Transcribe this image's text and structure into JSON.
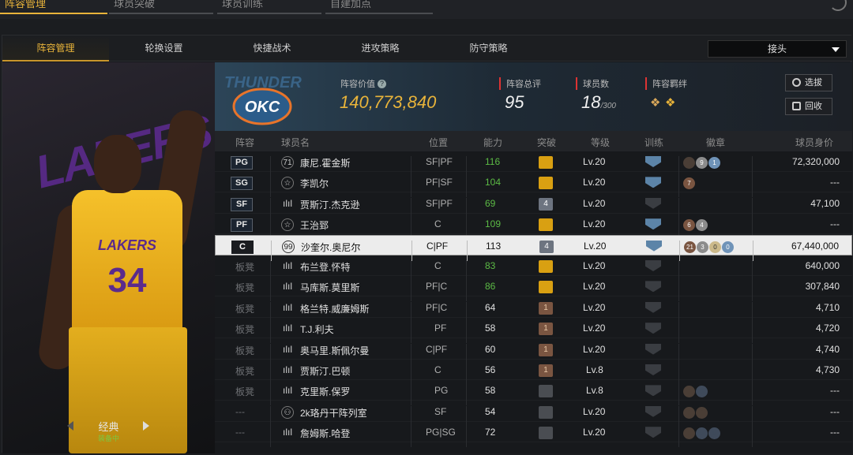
{
  "top_tabs": [
    {
      "label": "阵容管理",
      "active": true
    },
    {
      "label": "球员突破",
      "active": false
    },
    {
      "label": "球员训练",
      "active": false
    },
    {
      "label": "自建加点",
      "active": false
    }
  ],
  "sub_tabs": [
    {
      "label": "阵容管理",
      "active": true
    },
    {
      "label": "轮换设置",
      "active": false
    },
    {
      "label": "快捷战术",
      "active": false
    },
    {
      "label": "进攻策略",
      "active": false
    },
    {
      "label": "防守策略",
      "active": false
    }
  ],
  "dropdown": {
    "value": "接头"
  },
  "player_card": {
    "jersey_team": "LAKERS",
    "jersey_number": "34",
    "backdrop_text": "LAKERS",
    "label": "经典",
    "status": "装备中"
  },
  "team_logo": {
    "name": "THUNDER",
    "abbr": "OKC"
  },
  "summary": {
    "value_label": "阵容价值",
    "value": "140,773,840",
    "rating_label": "阵容总评",
    "rating": "95",
    "count_label": "球员数",
    "count": "18",
    "count_max": "/300",
    "chem_label": "阵容羁绊"
  },
  "buttons": {
    "select": "选拔",
    "recycle": "回收"
  },
  "columns": [
    "阵容",
    "球员名",
    "位置",
    "能力",
    "突破",
    "等级",
    "训练",
    "徽章",
    "球员身价"
  ],
  "rows": [
    {
      "slot": "PG",
      "tag": "71",
      "name": "康尼.霍金斯",
      "pos": "SF|PF",
      "ability": "116",
      "ability_green": true,
      "bk": "crown",
      "bk_text": "",
      "level": "Lv.20",
      "train": true,
      "badges": [
        {
          "t": "d",
          "v": "4"
        },
        {
          "t": "s",
          "v": "9"
        },
        {
          "t": "bl",
          "v": "1"
        }
      ],
      "value": "72,320,000",
      "selected": false
    },
    {
      "slot": "SG",
      "tag": "☆",
      "name": "李凯尔",
      "pos": "PF|SF",
      "ability": "104",
      "ability_green": true,
      "bk": "crown",
      "bk_text": "",
      "level": "Lv.20",
      "train": true,
      "badges": [
        {
          "t": "b",
          "v": "7"
        }
      ],
      "value": "---",
      "selected": false
    },
    {
      "slot": "SF",
      "tag": "ılıl",
      "name": "贾斯汀.杰克逊",
      "pos": "SF|PF",
      "ability": "69",
      "ability_green": true,
      "bk": "num",
      "bk_text": "4",
      "level": "Lv.20",
      "train": false,
      "badges": [],
      "value": "47,100",
      "selected": false
    },
    {
      "slot": "PF",
      "tag": "☆",
      "name": "王治郅",
      "pos": "C",
      "ability": "109",
      "ability_green": true,
      "bk": "crown",
      "bk_text": "",
      "level": "Lv.20",
      "train": true,
      "badges": [
        {
          "t": "b",
          "v": "6"
        },
        {
          "t": "s",
          "v": "4"
        }
      ],
      "value": "---",
      "selected": false
    },
    {
      "slot": "C",
      "tag": "99",
      "name": "沙奎尔.奥尼尔",
      "pos": "C|PF",
      "ability": "113",
      "ability_green": false,
      "bk": "num",
      "bk_text": "4",
      "level": "Lv.20",
      "train": true,
      "badges": [
        {
          "t": "b",
          "v": "21"
        },
        {
          "t": "s",
          "v": "3"
        },
        {
          "t": "g",
          "v": "0"
        },
        {
          "t": "bl",
          "v": "0"
        }
      ],
      "value": "67,440,000",
      "selected": true
    },
    {
      "slot": "板凳",
      "tag": "ılıl",
      "name": "布兰登.怀特",
      "pos": "C",
      "ability": "83",
      "ability_green": true,
      "bk": "crown",
      "bk_text": "",
      "level": "Lv.20",
      "train": false,
      "badges": [],
      "value": "640,000",
      "selected": false
    },
    {
      "slot": "板凳",
      "tag": "ılıl",
      "name": "马库斯.莫里斯",
      "pos": "PF|C",
      "ability": "86",
      "ability_green": true,
      "bk": "crown",
      "bk_text": "",
      "level": "Lv.20",
      "train": false,
      "badges": [],
      "value": "307,840",
      "selected": false
    },
    {
      "slot": "板凳",
      "tag": "ılıl",
      "name": "格兰特.威廉姆斯",
      "pos": "PF|C",
      "ability": "64",
      "ability_green": false,
      "bk": "bronze",
      "bk_text": "1",
      "level": "Lv.20",
      "train": false,
      "badges": [],
      "value": "4,710",
      "selected": false
    },
    {
      "slot": "板凳",
      "tag": "ılıl",
      "name": "T.J.利夫",
      "pos": "PF",
      "ability": "58",
      "ability_green": false,
      "bk": "bronze",
      "bk_text": "1",
      "level": "Lv.20",
      "train": false,
      "badges": [],
      "value": "4,720",
      "selected": false
    },
    {
      "slot": "板凳",
      "tag": "ılıl",
      "name": "奥马里.斯佩尔曼",
      "pos": "C|PF",
      "ability": "60",
      "ability_green": false,
      "bk": "bronze",
      "bk_text": "1",
      "level": "Lv.20",
      "train": false,
      "badges": [],
      "value": "4,740",
      "selected": false
    },
    {
      "slot": "板凳",
      "tag": "ılıl",
      "name": "贾斯汀.巴顿",
      "pos": "C",
      "ability": "56",
      "ability_green": false,
      "bk": "bronze",
      "bk_text": "1",
      "level": "Lv.8",
      "train": false,
      "badges": [],
      "value": "4,730",
      "selected": false
    },
    {
      "slot": "板凳",
      "tag": "ılıl",
      "name": "克里斯.保罗",
      "pos": "PG",
      "ability": "58",
      "ability_green": false,
      "bk": "gray",
      "bk_text": "",
      "level": "Lv.8",
      "train": false,
      "badges": [
        {
          "t": "d",
          "v": "0"
        },
        {
          "t": "dg",
          "v": "0"
        }
      ],
      "value": "---",
      "selected": false
    },
    {
      "slot": "---",
      "tag": "⚇",
      "name": "2k珞丹干阵列室",
      "pos": "SF",
      "ability": "54",
      "ability_green": false,
      "bk": "gray",
      "bk_text": "",
      "level": "Lv.20",
      "train": false,
      "badges": [
        {
          "t": "d",
          "v": "0"
        },
        {
          "t": "d",
          "v": "0"
        }
      ],
      "value": "---",
      "selected": false
    },
    {
      "slot": "---",
      "tag": "ılıl",
      "name": "詹姆斯.哈登",
      "pos": "PG|SG",
      "ability": "72",
      "ability_green": false,
      "bk": "gray",
      "bk_text": "",
      "level": "Lv.20",
      "train": false,
      "badges": [
        {
          "t": "d",
          "v": "0"
        },
        {
          "t": "dg",
          "v": "0"
        },
        {
          "t": "dg",
          "v": "0"
        }
      ],
      "value": "---",
      "selected": false
    }
  ]
}
